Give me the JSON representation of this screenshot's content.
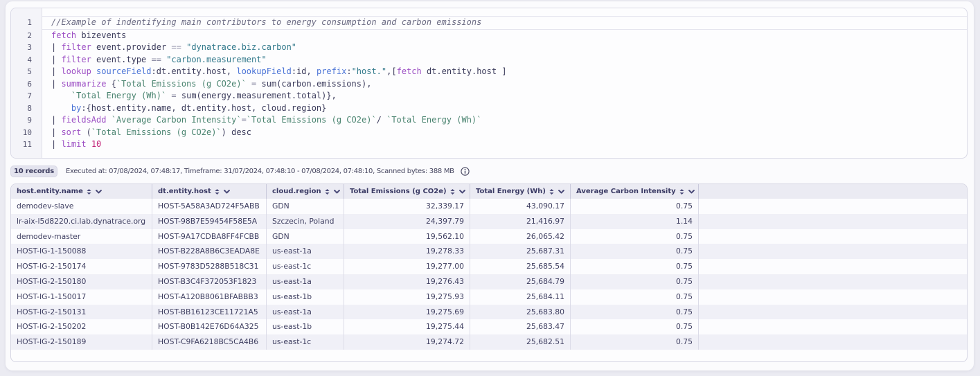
{
  "colors": {
    "page_background": "#ebebf2",
    "card_background": "#fbfbfd",
    "keyword_purple": "#9c4fc4",
    "parameter_blue": "#4a73d6",
    "string_teal": "#337a8c",
    "backtick_teal": "#49836f",
    "number_magenta": "#c22076",
    "header_navy": "#3a3a64"
  },
  "editor": {
    "active_line": 1,
    "line_numbers": [
      "1",
      "2",
      "3",
      "4",
      "5",
      "6",
      "7",
      "8",
      "9",
      "10",
      "11"
    ],
    "lines": [
      [
        {
          "type": "comment",
          "text": "//Example of indentifying main contributors to energy consumption and carbon emissions"
        }
      ],
      [
        {
          "type": "keyword",
          "text": "fetch"
        },
        {
          "type": "default",
          "text": " bizevents"
        }
      ],
      [
        {
          "type": "default",
          "text": "| "
        },
        {
          "type": "keyword",
          "text": "filter"
        },
        {
          "type": "default",
          "text": " event.provider "
        },
        {
          "type": "operator",
          "text": "=="
        },
        {
          "type": "default",
          "text": " "
        },
        {
          "type": "string",
          "text": "\"dynatrace.biz.carbon\""
        }
      ],
      [
        {
          "type": "default",
          "text": "| "
        },
        {
          "type": "keyword",
          "text": "filter"
        },
        {
          "type": "default",
          "text": " event.type "
        },
        {
          "type": "operator",
          "text": "=="
        },
        {
          "type": "default",
          "text": " "
        },
        {
          "type": "string",
          "text": "\"carbon.measurement\""
        }
      ],
      [
        {
          "type": "default",
          "text": "| "
        },
        {
          "type": "keyword",
          "text": "lookup"
        },
        {
          "type": "default",
          "text": " "
        },
        {
          "type": "param",
          "text": "sourceField"
        },
        {
          "type": "default",
          "text": ":dt.entity.host, "
        },
        {
          "type": "param",
          "text": "lookupField"
        },
        {
          "type": "default",
          "text": ":id, "
        },
        {
          "type": "param",
          "text": "prefix"
        },
        {
          "type": "default",
          "text": ":"
        },
        {
          "type": "string",
          "text": "\"host.\""
        },
        {
          "type": "default",
          "text": ",["
        },
        {
          "type": "keyword",
          "text": "fetch"
        },
        {
          "type": "default",
          "text": " dt.entity.host ]"
        }
      ],
      [
        {
          "type": "default",
          "text": "| "
        },
        {
          "type": "keyword",
          "text": "summarize"
        },
        {
          "type": "default",
          "text": " {"
        },
        {
          "type": "backtick",
          "text": "`Total Emissions (g CO2e)`"
        },
        {
          "type": "default",
          "text": " "
        },
        {
          "type": "operator",
          "text": "="
        },
        {
          "type": "default",
          "text": " sum(carbon.emissions),"
        }
      ],
      [
        {
          "type": "default",
          "text": "    "
        },
        {
          "type": "backtick",
          "text": "`Total Energy (Wh)`"
        },
        {
          "type": "default",
          "text": " "
        },
        {
          "type": "operator",
          "text": "="
        },
        {
          "type": "default",
          "text": " sum(energy.measurement.total)},"
        }
      ],
      [
        {
          "type": "default",
          "text": "    "
        },
        {
          "type": "param",
          "text": "by"
        },
        {
          "type": "default",
          "text": ":{host.entity.name, dt.entity.host, cloud.region}"
        }
      ],
      [
        {
          "type": "default",
          "text": "| "
        },
        {
          "type": "keyword",
          "text": "fieldsAdd"
        },
        {
          "type": "default",
          "text": " "
        },
        {
          "type": "backtick",
          "text": "`Average Carbon Intensity`"
        },
        {
          "type": "operator",
          "text": "="
        },
        {
          "type": "backtick",
          "text": "`Total Emissions (g CO2e)`"
        },
        {
          "type": "default",
          "text": "/ "
        },
        {
          "type": "backtick",
          "text": "`Total Energy (Wh)`"
        }
      ],
      [
        {
          "type": "default",
          "text": "| "
        },
        {
          "type": "keyword",
          "text": "sort"
        },
        {
          "type": "default",
          "text": " ("
        },
        {
          "type": "backtick",
          "text": "`Total Emissions (g CO2e)`"
        },
        {
          "type": "default",
          "text": ") desc"
        }
      ],
      [
        {
          "type": "default",
          "text": "| "
        },
        {
          "type": "keyword",
          "text": "limit"
        },
        {
          "type": "default",
          "text": " "
        },
        {
          "type": "number",
          "text": "10"
        }
      ]
    ]
  },
  "results_bar": {
    "records_badge": "10 records",
    "status_text": "Executed at: 07/08/2024, 07:48:17, Timeframe: 31/07/2024, 07:48:10 - 07/08/2024, 07:48:10, Scanned bytes: 388 MB",
    "info_icon": "info-circle-icon"
  },
  "table": {
    "header_icons": [
      "sort-icon",
      "chevron-down-icon"
    ],
    "columns": [
      {
        "label": "host.entity.name",
        "align": "left"
      },
      {
        "label": "dt.entity.host",
        "align": "left"
      },
      {
        "label": "cloud.region",
        "align": "left"
      },
      {
        "label": "Total Emissions (g CO2e)",
        "align": "right"
      },
      {
        "label": "Total Energy (Wh)",
        "align": "right"
      },
      {
        "label": "Average Carbon Intensity",
        "align": "right"
      }
    ],
    "rows": [
      [
        "demodev-slave",
        "HOST-5A58A3AD724F5ABB",
        "GDN",
        "32,339.17",
        "43,090.17",
        "0.75"
      ],
      [
        "lr-aix-l5d8220.ci.lab.dynatrace.org",
        "HOST-98B7E59454F58E5A",
        "Szczecin, Poland",
        "24,397.79",
        "21,416.97",
        "1.14"
      ],
      [
        "demodev-master",
        "HOST-9A17CDBA8FF4FCBB",
        "GDN",
        "19,562.10",
        "26,065.42",
        "0.75"
      ],
      [
        "HOST-IG-1-150088",
        "HOST-B228A8B6C3EADA8E",
        "us-east-1a",
        "19,278.33",
        "25,687.31",
        "0.75"
      ],
      [
        "HOST-IG-2-150174",
        "HOST-9783D5288B518C31",
        "us-east-1c",
        "19,277.00",
        "25,685.54",
        "0.75"
      ],
      [
        "HOST-IG-2-150180",
        "HOST-B3C4F372053F1823",
        "us-east-1a",
        "19,276.43",
        "25,684.79",
        "0.75"
      ],
      [
        "HOST-IG-1-150017",
        "HOST-A120B8061BFABBB3",
        "us-east-1b",
        "19,275.93",
        "25,684.11",
        "0.75"
      ],
      [
        "HOST-IG-2-150131",
        "HOST-BB16123CE11721A5",
        "us-east-1a",
        "19,275.69",
        "25,683.80",
        "0.75"
      ],
      [
        "HOST-IG-2-150202",
        "HOST-B0B142E76D64A325",
        "us-east-1b",
        "19,275.44",
        "25,683.47",
        "0.75"
      ],
      [
        "HOST-IG-2-150189",
        "HOST-C9FA6218BC5CA4B6",
        "us-east-1c",
        "19,274.72",
        "25,682.51",
        "0.75"
      ]
    ]
  }
}
